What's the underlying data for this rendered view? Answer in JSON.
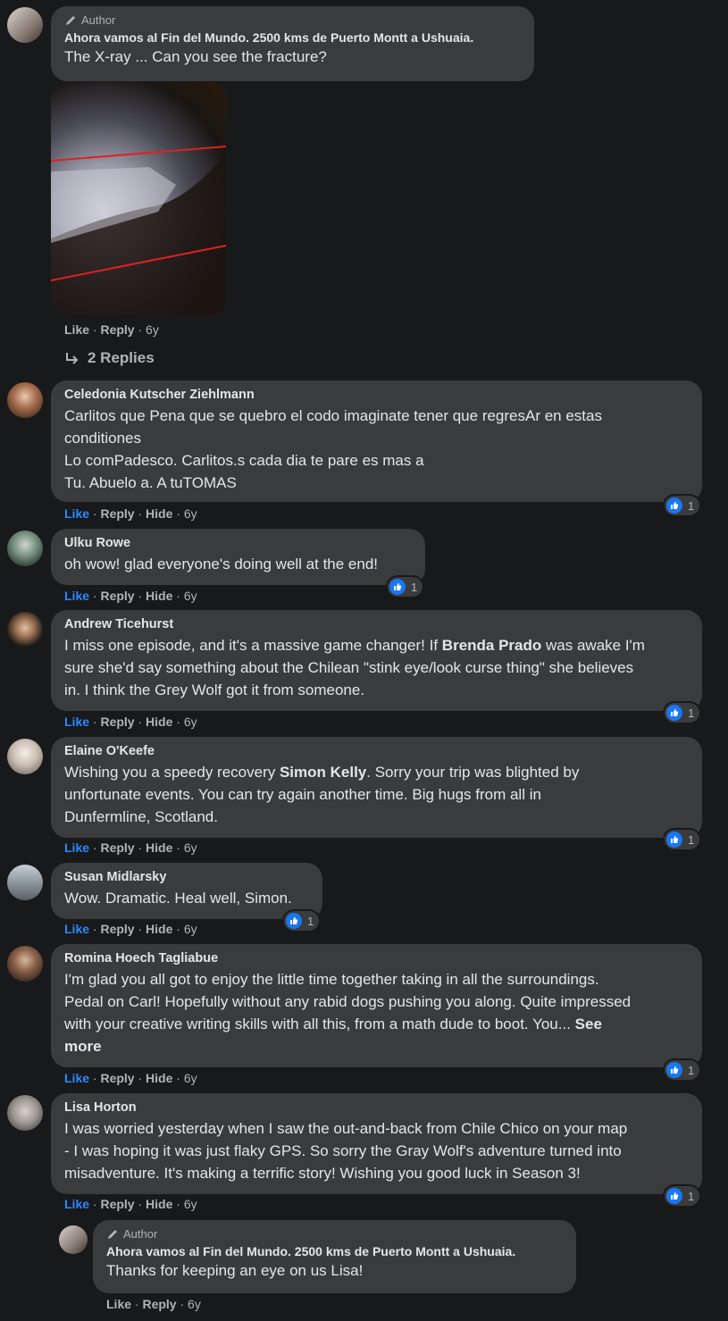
{
  "colors": {
    "background": "#18191a",
    "bubble": "#3a3b3c",
    "accent": "#2d88ff",
    "like": "#1877f2"
  },
  "thread": {
    "top": {
      "badge": "Author",
      "name": "Ahora vamos al Fin del Mundo. 2500 kms de Puerto Montt a Ushuaia.",
      "text": "The X-ray ... Can you see the fracture?",
      "like": "Like",
      "reply": "Reply",
      "time": "6y",
      "replies": "2 Replies"
    },
    "comments": [
      {
        "name": "Celedonia Kutscher Ziehlmann",
        "lines": [
          "Carlitos que Pena que se quebro el codo imaginate tener que regresAr en estas",
          "conditiones",
          "Lo comPadesco. Carlitos.s cada dia te pare es mas a",
          "Tu. Abuelo a. A tuTOMAS"
        ],
        "reactions": "1"
      },
      {
        "name": "Ulku Rowe",
        "lines": [
          "oh wow! glad everyone's doing well at the end!"
        ],
        "reactions": "1"
      },
      {
        "name": "Andrew Ticehurst",
        "seg": [
          "I miss one episode, and it's a massive game changer! If ",
          "Brenda Prado",
          " was awake I'm",
          "sure she'd say something about the Chilean \"stink eye/look curse thing\" she believes",
          "in. I think the Grey Wolf got it from someone."
        ],
        "reactions": "1"
      },
      {
        "name": "Elaine O'Keefe",
        "seg": [
          "Wishing you a speedy recovery ",
          "Simon Kelly",
          ". Sorry your trip was blighted by",
          "unfortunate events. You can try again another time. Big hugs from all in",
          "Dunfermline, Scotland."
        ],
        "reactions": "1"
      },
      {
        "name": "Susan Midlarsky",
        "lines": [
          "Wow. Dramatic. Heal well, Simon."
        ],
        "reactions": "1"
      },
      {
        "name": "Romina Hoech Tagliabue",
        "lines": [
          "I'm glad you all got to enjoy the little time together taking in all the surroundings.",
          "Pedal on Carl! Hopefully without any rabid dogs pushing you along. Quite impressed",
          "with your creative writing skills with all this, from a math dude to boot. You... "
        ],
        "see_more_a": "See",
        "see_more_b": "more",
        "reactions": "1"
      },
      {
        "name": "Lisa Horton",
        "lines": [
          "I was worried yesterday when I saw the out-and-back from Chile Chico on your map",
          "- I was hoping it was just flaky GPS. So sorry the Gray Wolf's adventure turned into",
          "misadventure. It's making a terrific story! Wishing you good luck in Season 3!"
        ],
        "reactions": "1"
      }
    ],
    "actions": {
      "like": "Like",
      "reply": "Reply",
      "hide": "Hide",
      "time": "6y",
      "sep": "·"
    },
    "author_reply": {
      "badge": "Author",
      "name": "Ahora vamos al Fin del Mundo. 2500 kms de Puerto Montt a Ushuaia.",
      "text": "Thanks for keeping an eye on us Lisa!",
      "like": "Like",
      "reply": "Reply",
      "time": "6y"
    }
  }
}
